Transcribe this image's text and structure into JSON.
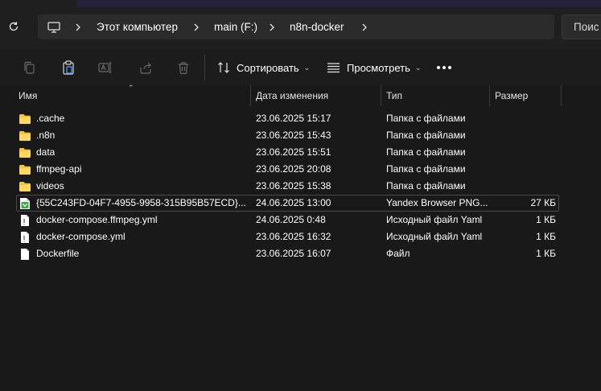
{
  "address_bar": {
    "segments": [
      "Этот компьютер",
      "main (F:)",
      "n8n-docker"
    ],
    "search_placeholder": "Поис"
  },
  "toolbar": {
    "sort_label": "Сортировать",
    "view_label": "Просмотреть"
  },
  "columns": {
    "name": "Имя",
    "date": "Дата изменения",
    "type": "Тип",
    "size": "Размер"
  },
  "files": [
    {
      "name": ".cache",
      "date": "23.06.2025 15:17",
      "type": "Папка с файлами",
      "size": "",
      "icon": "folder-icon"
    },
    {
      "name": ".n8n",
      "date": "23.06.2025 15:43",
      "type": "Папка с файлами",
      "size": "",
      "icon": "folder-icon"
    },
    {
      "name": "data",
      "date": "23.06.2025 15:51",
      "type": "Папка с файлами",
      "size": "",
      "icon": "folder-icon"
    },
    {
      "name": "ffmpeg-api",
      "date": "23.06.2025 20:08",
      "type": "Папка с файлами",
      "size": "",
      "icon": "folder-icon"
    },
    {
      "name": "videos",
      "date": "23.06.2025 15:38",
      "type": "Папка с файлами",
      "size": "",
      "icon": "folder-icon"
    },
    {
      "name": "{55C243FD-04F7-4955-9958-315B95B57ECD}...",
      "date": "24.06.2025 13:00",
      "type": "Yandex Browser PNG...",
      "size": "27 КБ",
      "icon": "png-file-icon"
    },
    {
      "name": "docker-compose.ffmpeg.yml",
      "date": "24.06.2025 0:48",
      "type": "Исходный файл Yaml",
      "size": "1 КБ",
      "icon": "yaml-file-icon"
    },
    {
      "name": "docker-compose.yml",
      "date": "23.06.2025 16:32",
      "type": "Исходный файл Yaml",
      "size": "1 КБ",
      "icon": "yaml-file-icon"
    },
    {
      "name": "Dockerfile",
      "date": "23.06.2025 16:07",
      "type": "Файл",
      "size": "1 КБ",
      "icon": "file-icon"
    }
  ],
  "colors": {
    "folder": "#f5c542",
    "png_icon": "#3aa94a",
    "background": "#191919"
  }
}
